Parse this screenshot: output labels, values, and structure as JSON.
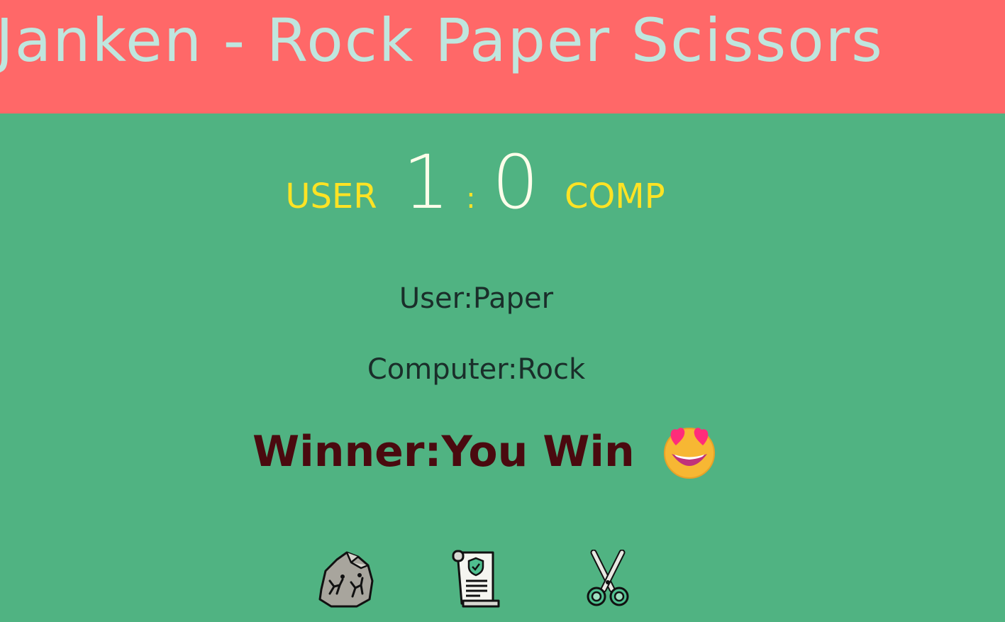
{
  "header": {
    "title": "Janken - Rock Paper Scissors"
  },
  "score": {
    "user_label": "USER",
    "user_score": "1",
    "separator": ":",
    "comp_score": "0",
    "comp_label": "COMP"
  },
  "result": {
    "user_pick": "User:Paper",
    "computer_pick": "Computer:Rock",
    "winner": "Winner:You Win",
    "emoji_icon": "star-struck-heart-eyes-emoji"
  },
  "choices": [
    {
      "name": "Rock",
      "icon": "rock-icon"
    },
    {
      "name": "Paper",
      "icon": "scroll-paper-icon"
    },
    {
      "name": "Scissors",
      "icon": "scissors-icon"
    }
  ],
  "colors": {
    "header_bg": "#ff6868",
    "title": "#bfe6de",
    "body_bg": "#50b382",
    "label_yellow": "#ffe324",
    "score_white": "#fdfdea",
    "winner_text": "#4a0a0f"
  }
}
